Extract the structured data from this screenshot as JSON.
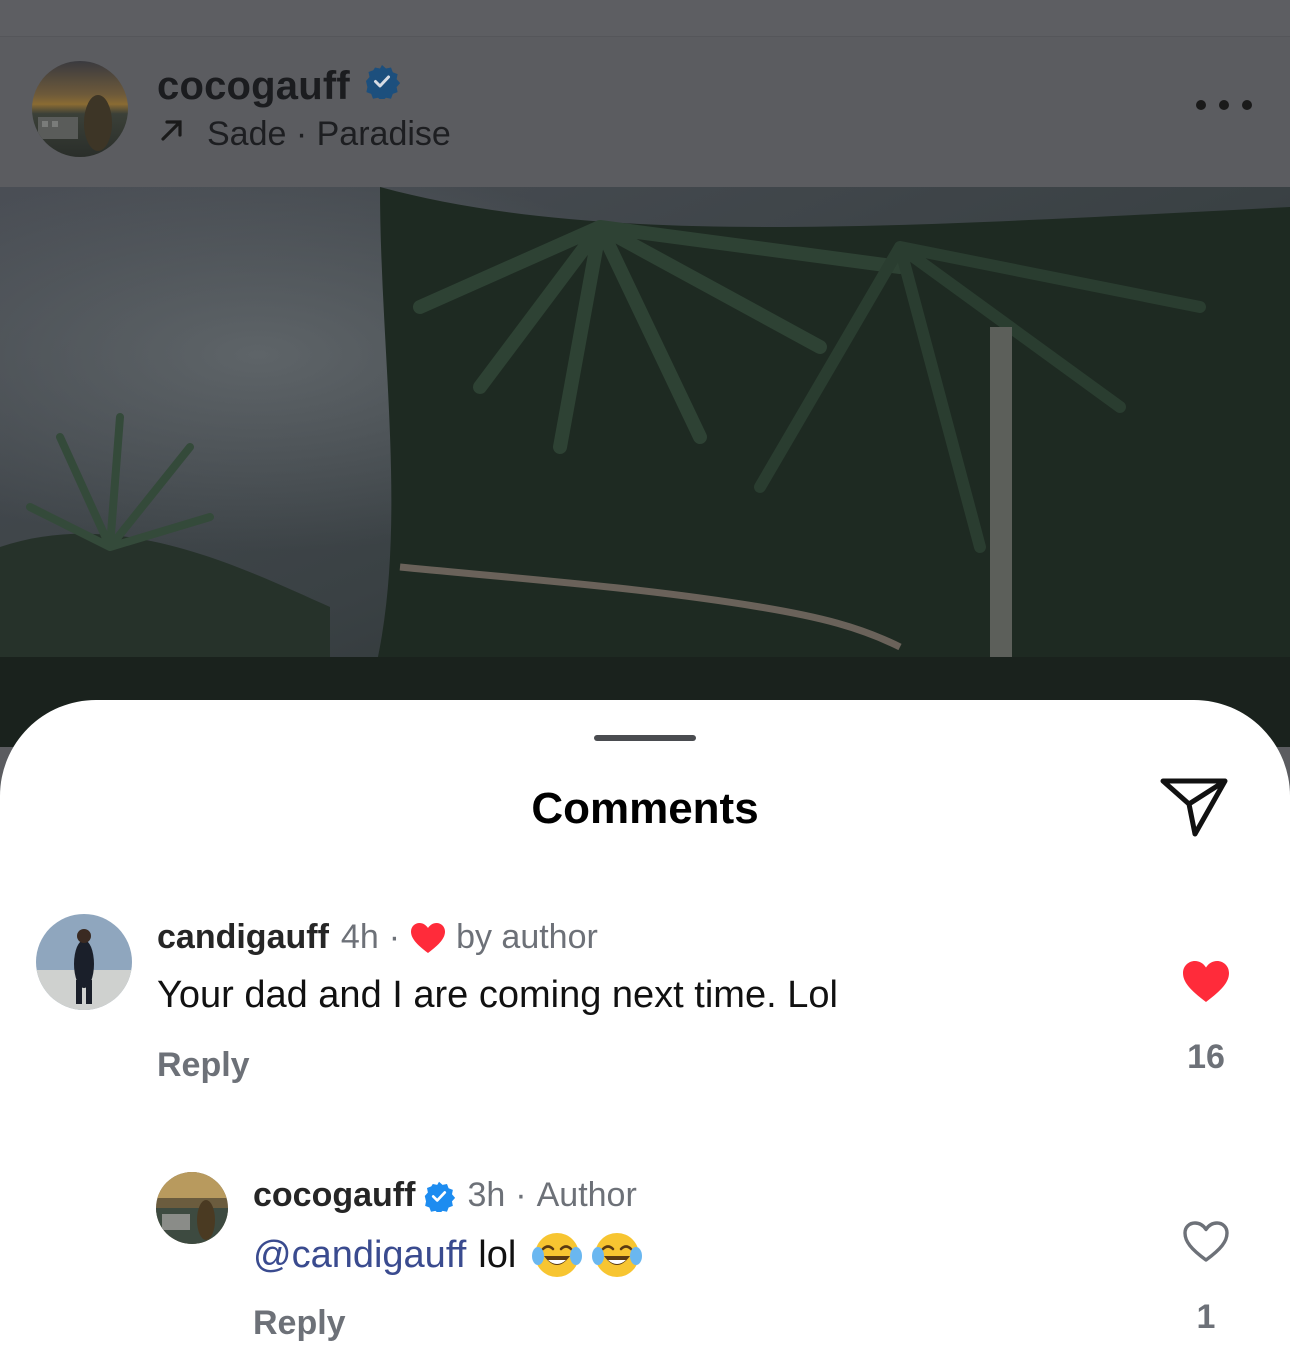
{
  "post": {
    "username": "cocogauff",
    "music": "Sade · Paradise"
  },
  "sheet": {
    "title": "Comments"
  },
  "comments": [
    {
      "username": "candigauff",
      "time": "4h",
      "liked_by_author_label": "by author",
      "text": "Your dad and I are coming next time. Lol",
      "reply_label": "Reply",
      "like_count": "16",
      "liked": true
    },
    {
      "username": "cocogauff",
      "verified": true,
      "time": "3h",
      "author_label": "Author",
      "mention": "@candigauff",
      "text": "lol",
      "emojis": [
        "face-with-tears-of-joy",
        "face-with-tears-of-joy"
      ],
      "reply_label": "Reply",
      "like_count": "1",
      "liked": false
    }
  ],
  "colors": {
    "accent_like": "#ff2b3a",
    "verified_badge": "#1d8cf0",
    "mention": "#3a4b8f"
  }
}
